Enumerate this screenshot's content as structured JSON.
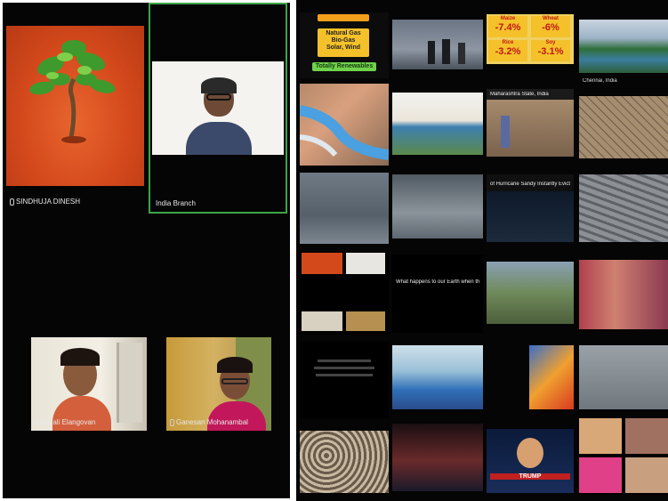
{
  "left_call": {
    "participants": [
      {
        "name": "SINDHUJA DINESH"
      },
      {
        "name": "India Branch"
      },
      {
        "name": "Gnanjali Elangovan"
      },
      {
        "name": "Ganesan Mohanambal"
      }
    ]
  },
  "right_grid": {
    "energy_slide": {
      "lines": [
        "Natural Gas",
        "Bio-Gas",
        "Solar, Wind"
      ],
      "footer": "Totally Renewables"
    },
    "yield_stats": [
      {
        "label": "Maize",
        "value": "-7.4%"
      },
      {
        "label": "Wheat",
        "value": "-6%"
      },
      {
        "label": "Rice",
        "value": "-3.2%"
      },
      {
        "label": "Soy",
        "value": "-3.1%"
      }
    ],
    "captions": {
      "chennai": "Chennai, India",
      "maharashtra": "Maharashtra State, India",
      "hurricane": "of Hurricane Sandy Instantly Evicts New York",
      "earth": "What happens to our Earth when the",
      "trump": "TRUMP"
    }
  },
  "colors": {
    "background": "#050505",
    "active_speaker_border": "#3aa548",
    "stat_bg": "#f4c12a",
    "stat_text": "#c01818",
    "energy_green": "#6fd24a"
  }
}
